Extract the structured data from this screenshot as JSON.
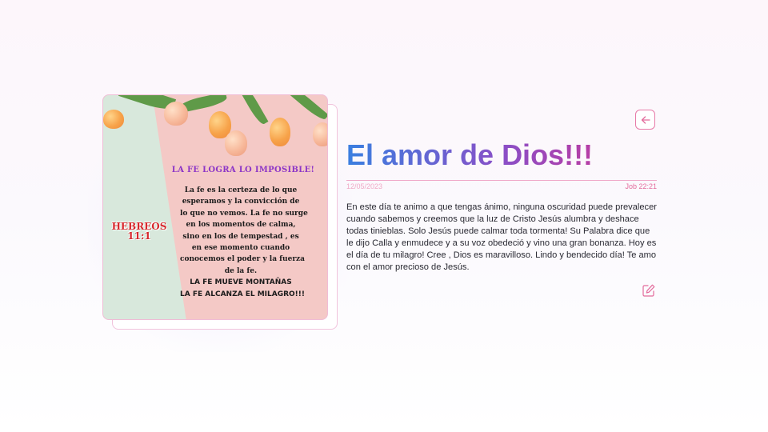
{
  "post": {
    "title": "El amor de Dios!!!",
    "date": "12/05/2023",
    "author_time": "Job 22:21",
    "body": "En este día te animo a que tengas ánimo, ninguna oscuridad puede prevalecer cuando sabemos y creemos que la luz de Cristo Jesús alumbra y deshace todas tinieblas. Solo Jesús puede calmar toda tormenta! Su Palabra dice que le dijo Calla y enmudece y a su voz obedeció y vino una gran bonanza. Hoy es el día de tu milagro! Cree , Dios es maravilloso. Lindo y bendecido día! Te amo con el amor precioso de Jesús."
  },
  "card_image": {
    "heading": "LA FE LOGRA LO IMPOSIBLE!",
    "reference_line1": "HEBREOS",
    "reference_line2": "11:1",
    "lines": [
      "La fe es la certeza de lo que",
      "esperamos y la convicción de",
      "lo que no vemos. La fe no surge",
      "en los momentos de calma,",
      "sino en los de tempestad , es",
      "en ese momento cuando",
      "conocemos el poder y la fuerza",
      "de la fe."
    ],
    "closing_line1": "LA FE MUEVE MONTAÑAS",
    "closing_line2": "LA FE ALCANZA EL MILAGRO!!!"
  },
  "icons": {
    "back": "arrow-left-icon",
    "edit": "edit-pencil-icon"
  },
  "colors": {
    "accent_pink": "#e36b9c",
    "title_gradient_start": "#3a7fe0",
    "title_gradient_end": "#d7318c"
  }
}
